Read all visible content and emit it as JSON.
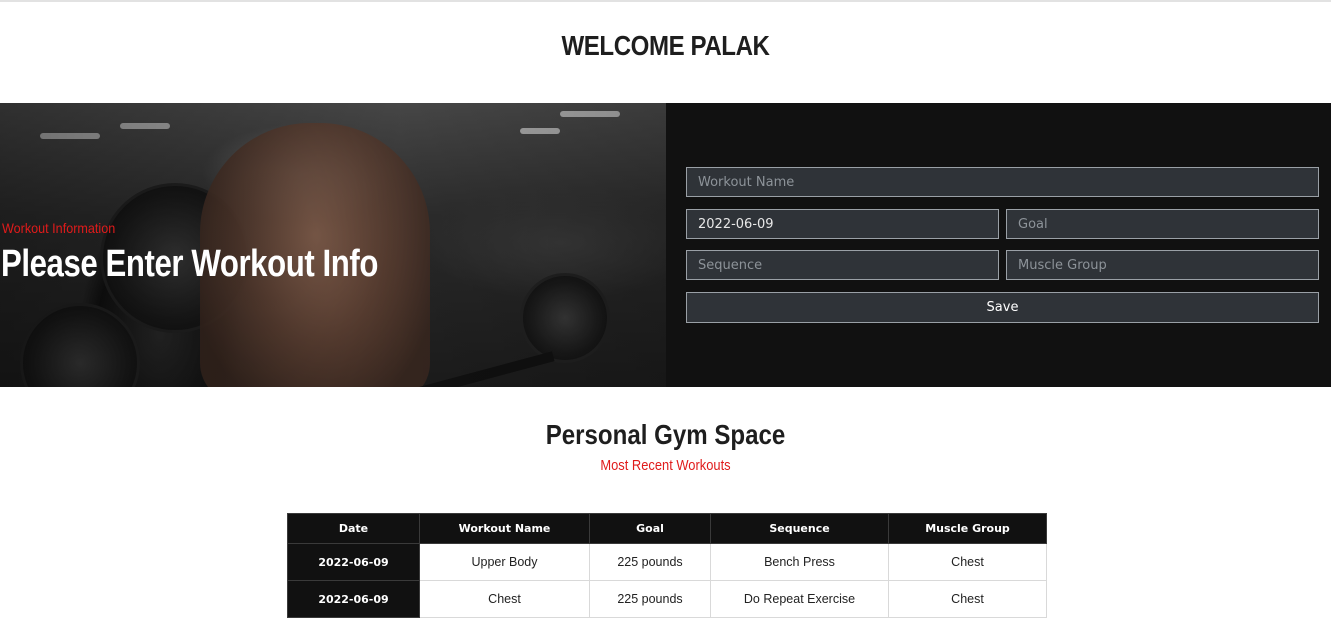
{
  "header": {
    "welcome": "WELCOME PALAK"
  },
  "hero": {
    "kicker": "Workout Information",
    "heading": "Please Enter Workout Info"
  },
  "form": {
    "workout_name_placeholder": "Workout Name",
    "date_value": "2022-06-09",
    "goal_placeholder": "Goal",
    "sequence_placeholder": "Sequence",
    "muscle_group_placeholder": "Muscle Group",
    "save_label": "Save"
  },
  "section": {
    "title": "Personal Gym Space",
    "subtitle": "Most Recent Workouts"
  },
  "table": {
    "headers": [
      "Date",
      "Workout Name",
      "Goal",
      "Sequence",
      "Muscle Group"
    ],
    "rows": [
      [
        "2022-06-09",
        "Upper Body",
        "225 pounds",
        "Bench Press",
        "Chest"
      ],
      [
        "2022-06-09",
        "Chest",
        "225 pounds",
        "Do Repeat Exercise",
        "Chest"
      ]
    ]
  },
  "colors": {
    "accent_red": "#e01b1b",
    "panel_dark": "#111111",
    "input_bg": "#2f3338"
  }
}
